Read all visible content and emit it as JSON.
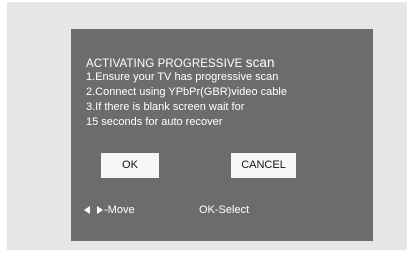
{
  "dialog": {
    "title_main": "ACTIVATING PROGRESSIVE",
    "title_scan": "scan",
    "lines": [
      "1.Ensure your TV has progressive scan",
      "2.Connect using YPbPr(GBR)video cable",
      "3.If there is blank screen wait for",
      "15 seconds for auto recover"
    ],
    "ok_label": "OK",
    "cancel_label": "CANCEL"
  },
  "hints": {
    "move_label": "-Move",
    "select_label": "OK-Select",
    "move_icons": [
      "left-arrow-icon",
      "right-arrow-icon"
    ]
  },
  "colors": {
    "backdrop": "#e6e6e6",
    "dialog_bg": "#6c6c6c",
    "button_bg": "#f7f7f7",
    "text": "#ffffff"
  }
}
